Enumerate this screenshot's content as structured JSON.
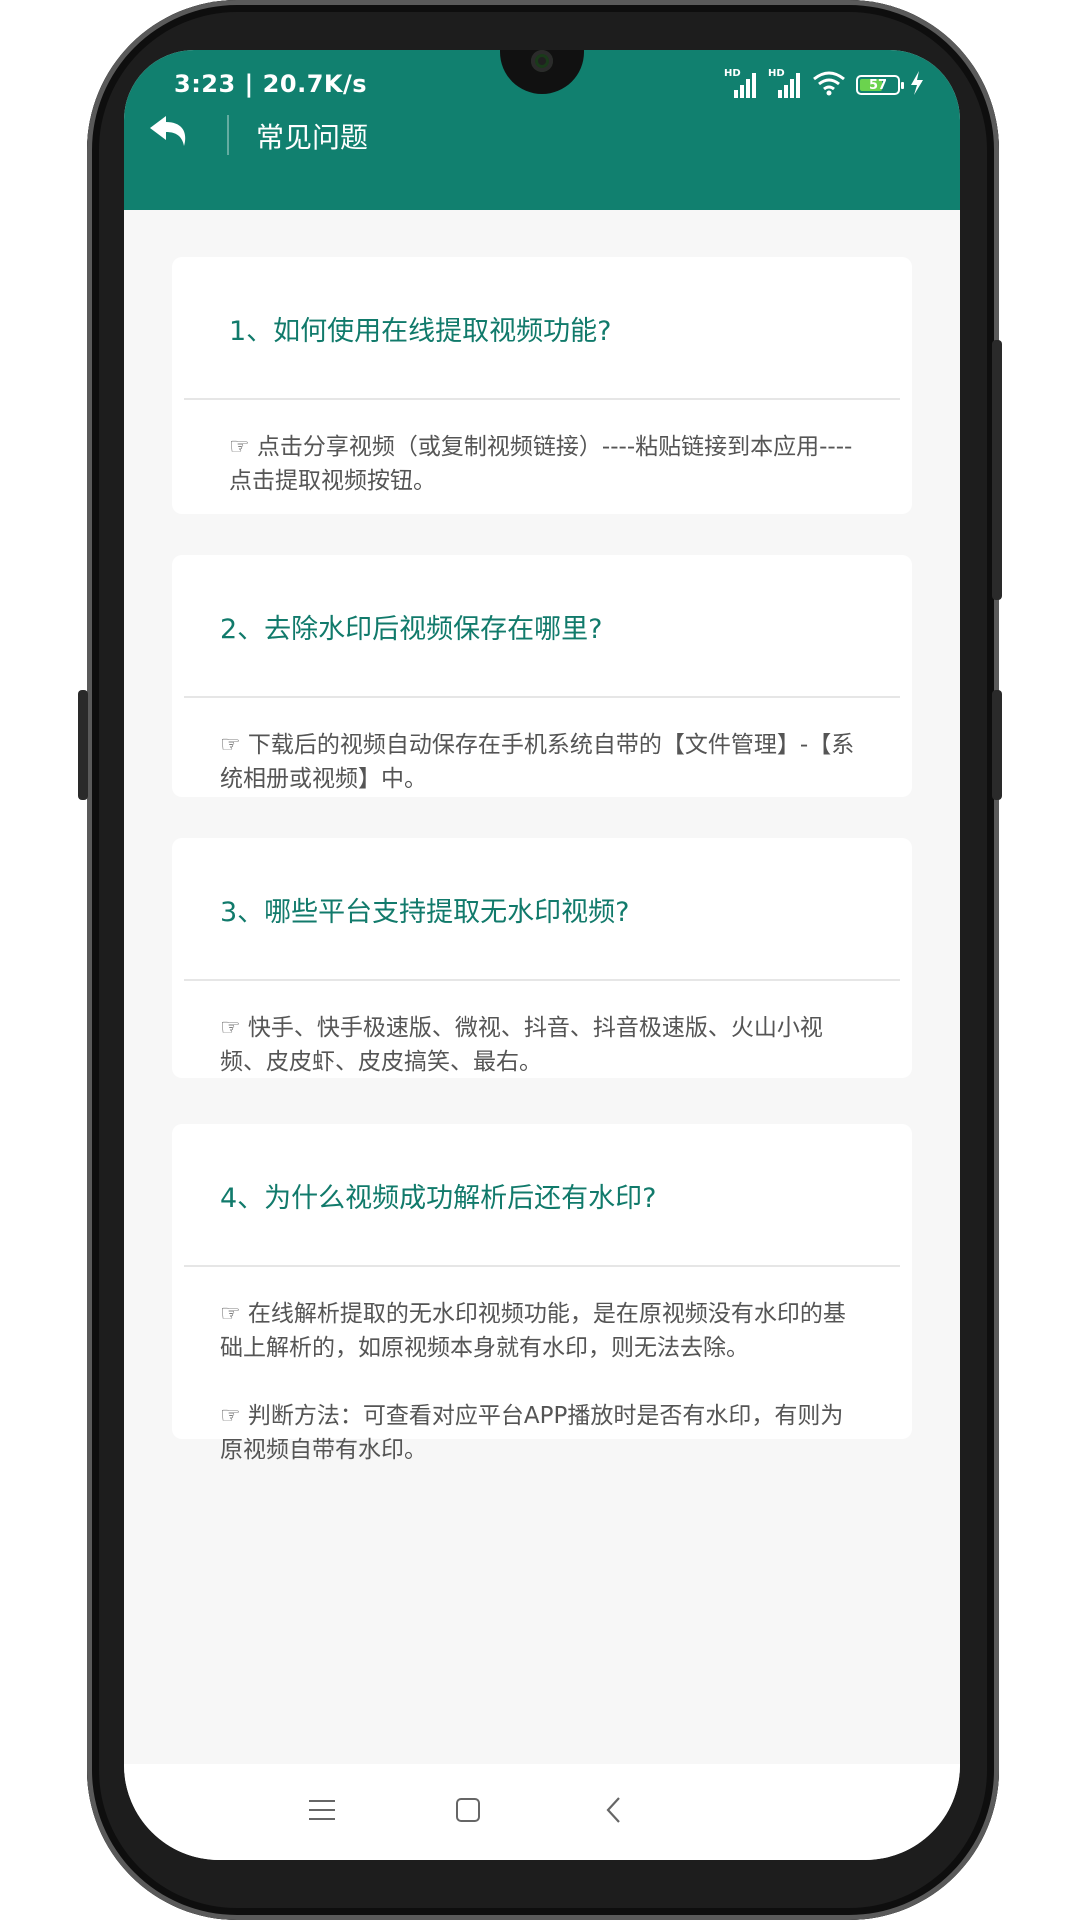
{
  "status_bar": {
    "time_speed": "3:23 | 20.7K/s",
    "signal1_label": "HD",
    "signal2_label": "HD",
    "battery_level": "57",
    "wifi_icon": "wifi-icon",
    "charging_icon": "charging-icon"
  },
  "app_bar": {
    "title": "常见问题",
    "back_icon": "back-arrow-icon",
    "color": "#11806f"
  },
  "faq": [
    {
      "question": "1、如何使用在线提取视频功能?",
      "answers": [
        "☞ 点击分享视频（或复制视频链接）----粘贴链接到本应用----点击提取视频按钮。"
      ]
    },
    {
      "question": "2、去除水印后视频保存在哪里?",
      "answers": [
        "☞ 下载后的视频自动保存在手机系统自带的【文件管理】-【系统相册或视频】中。"
      ]
    },
    {
      "question": "3、哪些平台支持提取无水印视频?",
      "answers": [
        "☞ 快手、快手极速版、微视、抖音、抖音极速版、火山小视频、皮皮虾、皮皮搞笑、最右。"
      ]
    },
    {
      "question": "4、为什么视频成功解析后还有水印?",
      "answers": [
        "☞ 在线解析提取的无水印视频功能，是在原视频没有水印的基础上解析的，如原视频本身就有水印，则无法去除。",
        "☞ 判断方法：可查看对应平台APP播放时是否有水印，有则为原视频自带有水印。"
      ]
    }
  ],
  "nav_bar": {
    "menu_icon": "menu-icon",
    "home_icon": "home-icon",
    "back_icon": "back-chevron-icon"
  },
  "colors": {
    "accent": "#11806f",
    "question_text": "#117a6b",
    "answer_text": "#555555"
  }
}
